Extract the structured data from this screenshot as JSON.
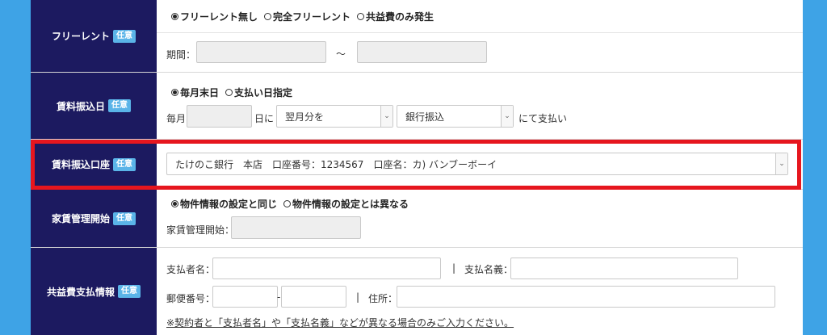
{
  "free_rent": {
    "label": "フリーレント",
    "badge": "任意",
    "options": [
      {
        "label": "フリーレント無し",
        "selected": true
      },
      {
        "label": "完全フリーレント",
        "selected": false
      },
      {
        "label": "共益費のみ発生",
        "selected": false
      }
    ],
    "period_label": "期間：",
    "tilde": "～"
  },
  "rent_transfer_day": {
    "label": "賃料振込日",
    "badge": "任意",
    "options": [
      {
        "label": "毎月末日",
        "selected": true
      },
      {
        "label": "支払い日指定",
        "selected": false
      }
    ],
    "prefix": "毎月",
    "day_suffix": "日に",
    "month_select": "翌月分を",
    "method_select": "銀行振込",
    "suffix": "にて支払い"
  },
  "rent_transfer_account": {
    "label": "賃料振込口座",
    "badge": "任意",
    "selected_account": "たけのこ銀行　本店　口座番号：1234567　口座名：カ) バンブーボーイ"
  },
  "rent_management_start": {
    "label": "家賃管理開始",
    "badge": "任意",
    "options": [
      {
        "label": "物件情報の設定と同じ",
        "selected": true
      },
      {
        "label": "物件情報の設定とは異なる",
        "selected": false
      }
    ],
    "start_label": "家賃管理開始："
  },
  "common_fee_payment": {
    "label": "共益費支払情報",
    "badge": "任意",
    "payer_label": "支払者名：",
    "separator": "|",
    "payer_name_label": "支払名義：",
    "postal_label": "郵便番号：",
    "postal_dash": "-",
    "address_label": "住所：",
    "note": "※契約者と「支払者名」や「支払名義」などが異なる場合のみご入力ください。"
  },
  "colors": {
    "label_bg": "#1c1a60",
    "badge_bg": "#5ab4e8",
    "highlight": "#e6161e",
    "side_bg": "#3ea3e6"
  }
}
